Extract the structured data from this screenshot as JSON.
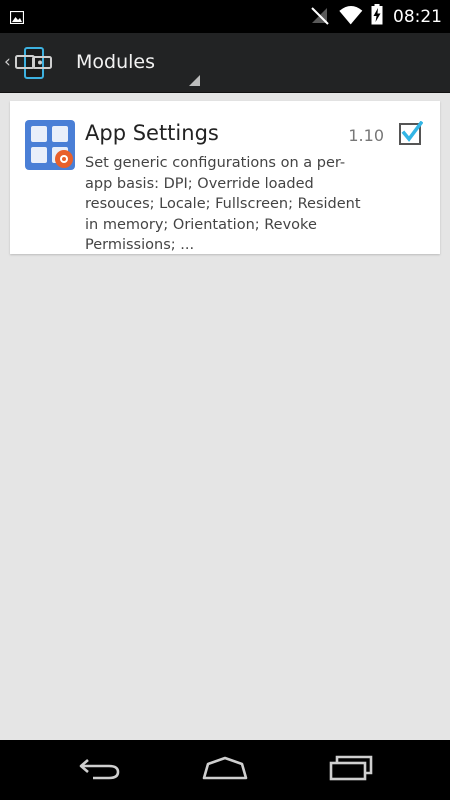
{
  "status_bar": {
    "time": "08:21",
    "icons": [
      "gallery-icon",
      "signal-off-icon",
      "wifi-icon",
      "battery-charging-icon"
    ]
  },
  "action_bar": {
    "title": "Modules",
    "icons": [
      "back-caret-icon",
      "xposed-app-icon",
      "spinner-arrow-icon"
    ]
  },
  "modules": [
    {
      "name": "App Settings",
      "version": "1.10",
      "enabled": true,
      "description": "Set generic configurations on a per-app basis: DPI; Override loaded resouces; Locale; Fullscreen; Resident in memory; Orientation; Revoke Permissions; ...",
      "description_lines": [
        "Set generic configurations on a per-",
        "app basis: DPI; Override loaded",
        "resouces; Locale; Fullscreen; Resident",
        "in memory; Orientation; Revoke",
        "Permissions; ..."
      ],
      "icon": "app-settings-icon",
      "accent_colors": {
        "tile_blue": "#4a7fd6",
        "tile_orange": "#e8602c"
      }
    }
  ],
  "nav_bar": {
    "buttons": [
      "back-icon",
      "home-icon",
      "recents-icon"
    ]
  },
  "colors": {
    "status_bar": "#000000",
    "action_bar": "#222324",
    "background": "#e5e5e5",
    "card": "#ffffff",
    "checkbox_accent": "#33b5e5"
  }
}
